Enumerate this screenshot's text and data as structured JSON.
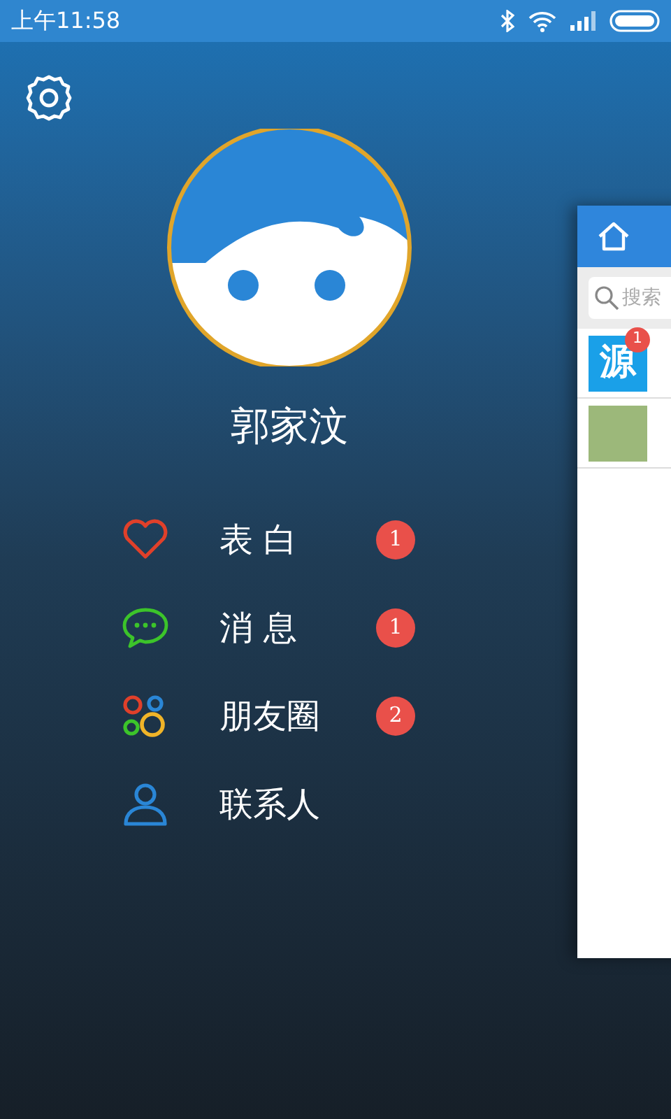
{
  "status_bar": {
    "time": "上午11:58"
  },
  "profile": {
    "name": "郭家汶"
  },
  "menu": [
    {
      "kind": "heart",
      "label": "表 白",
      "badge": "1"
    },
    {
      "kind": "chat",
      "label": "消 息",
      "badge": "1"
    },
    {
      "kind": "moments",
      "label": "朋友圈",
      "badge": "2"
    },
    {
      "kind": "contacts",
      "label": "联系人"
    }
  ],
  "side_panel": {
    "search": {
      "placeholder": "搜索"
    },
    "conversations": [
      {
        "kind": "logo",
        "logo_text": "源",
        "badge": "1"
      },
      {
        "kind": "photo"
      }
    ]
  }
}
